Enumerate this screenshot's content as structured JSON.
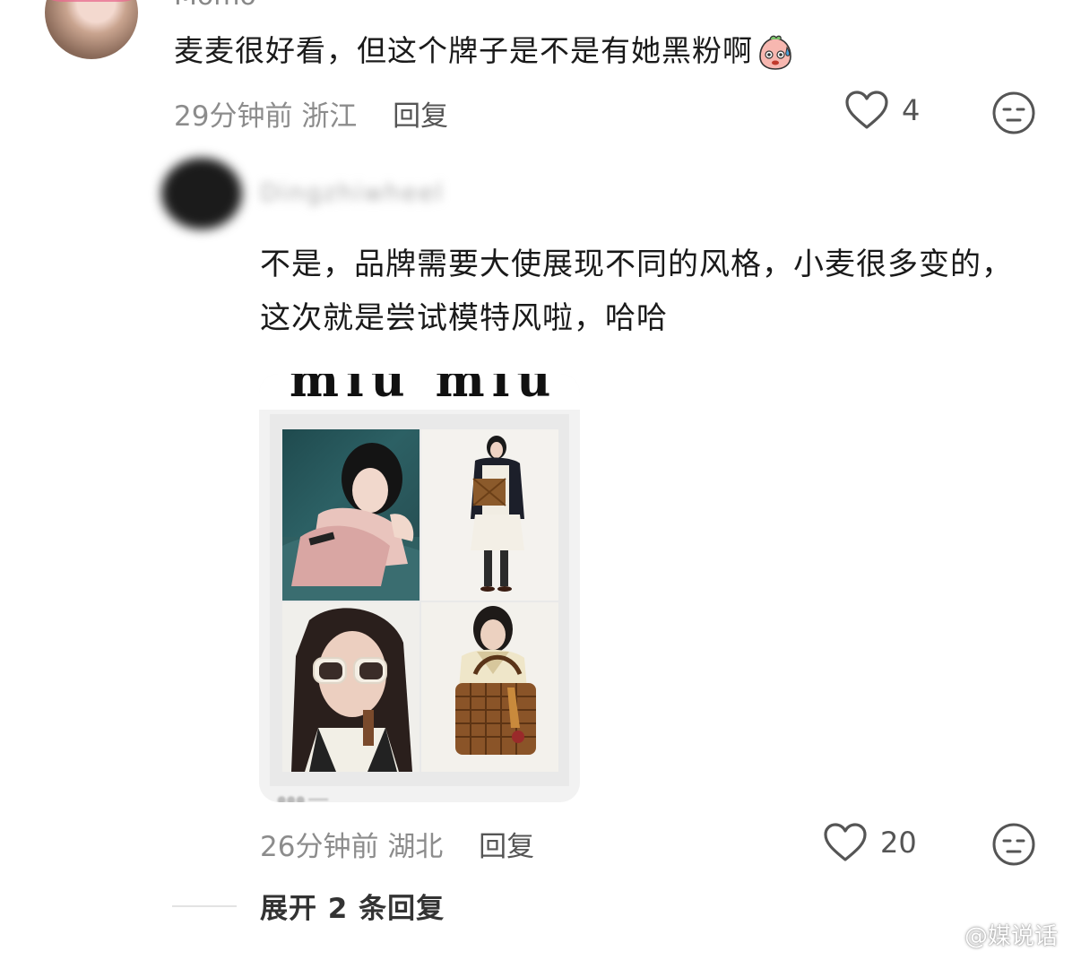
{
  "comment1": {
    "username": "Momo",
    "text": "麦麦很好看，但这个牌子是不是有她黑粉啊",
    "time": "29分钟前",
    "location": "浙江",
    "reply_label": "回复",
    "likes": "4"
  },
  "comment2": {
    "username": "Dingzhiwheel",
    "text": "不是，品牌需要大使展现不同的风格，小麦很多变的，这次就是尝试模特风啦，哈哈",
    "image": {
      "brand": "miu miu"
    },
    "time": "26分钟前",
    "location": "湖北",
    "reply_label": "回复",
    "likes": "20"
  },
  "expand_replies": "展开 2 条回复",
  "watermark": "@媒说话",
  "colors": {
    "text_primary": "#1a1a1a",
    "text_meta": "#8c8c8c",
    "icon_stroke": "#555555"
  }
}
